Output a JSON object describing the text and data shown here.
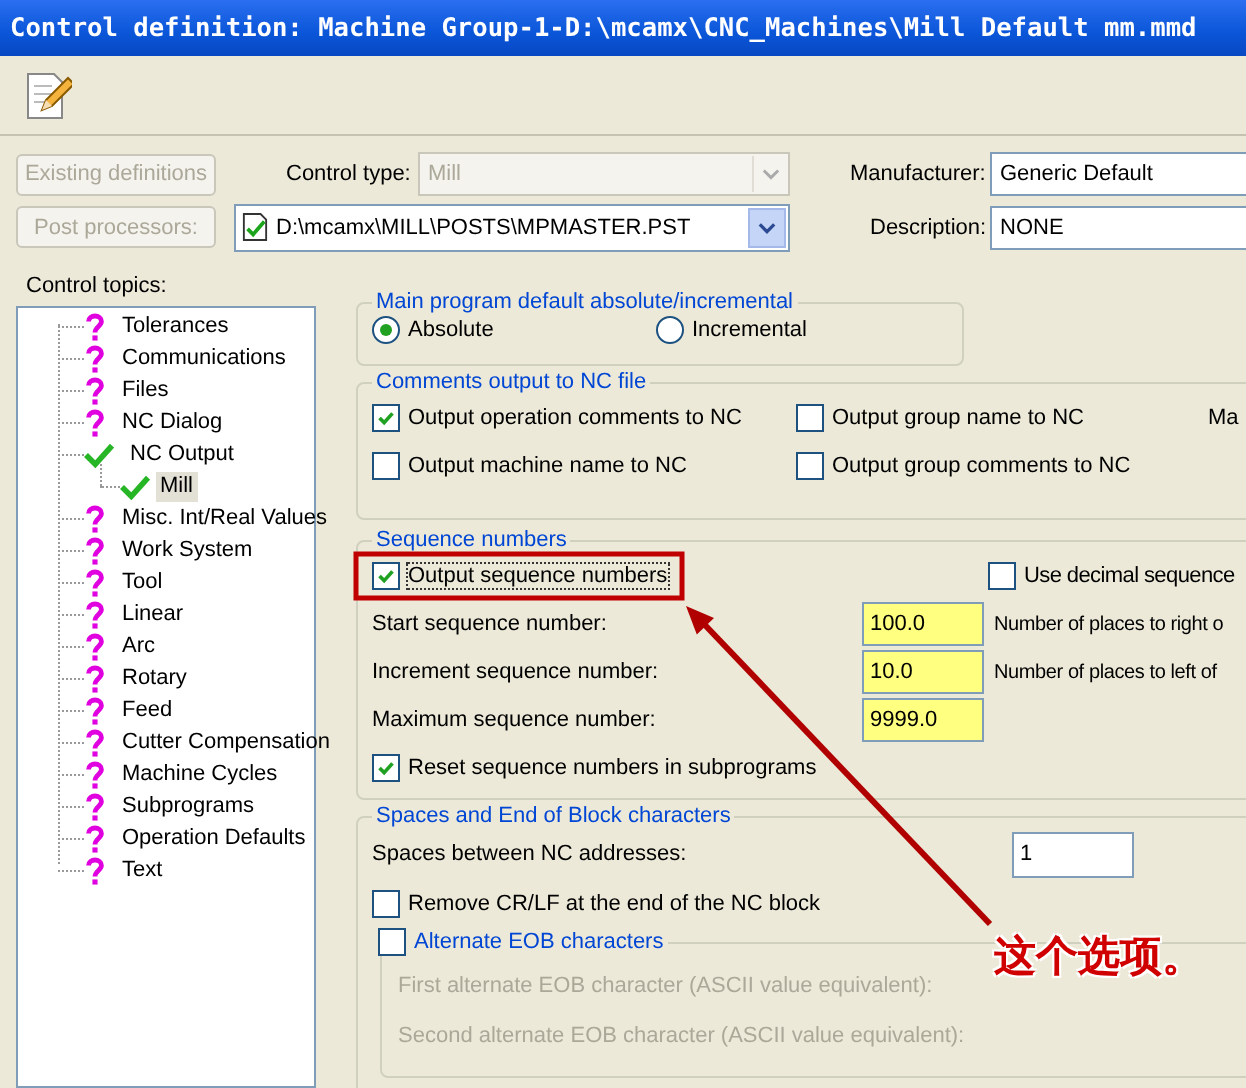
{
  "window": {
    "title": "Control definition: Machine Group-1-D:\\mcamx\\CNC_Machines\\Mill Default mm.mmd"
  },
  "definitions_button": {
    "label": "Existing definitions",
    "disabled": true
  },
  "control_type": {
    "label": "Control type:",
    "value": "Mill",
    "disabled": true
  },
  "post_button": {
    "label": "Post processors:",
    "disabled": true
  },
  "post_file": {
    "value": "D:\\mcamx\\MILL\\POSTS\\MPMASTER.PST"
  },
  "manufacturer": {
    "label": "Manufacturer:",
    "value": "Generic Default"
  },
  "description": {
    "label": "Description:",
    "value": "NONE"
  },
  "topics": {
    "label": "Control topics:",
    "items": [
      {
        "label": "Tolerances",
        "kind": "question",
        "selected": false
      },
      {
        "label": "Communications",
        "kind": "question",
        "selected": false
      },
      {
        "label": "Files",
        "kind": "question",
        "selected": false
      },
      {
        "label": "NC Dialog",
        "kind": "question",
        "selected": false
      },
      {
        "label": "NC Output",
        "kind": "check",
        "selected": false,
        "expanded": true,
        "children": [
          {
            "label": "Mill",
            "kind": "check",
            "selected": true
          }
        ]
      },
      {
        "label": "Misc. Int/Real Values",
        "kind": "question",
        "selected": false
      },
      {
        "label": "Work System",
        "kind": "question",
        "selected": false
      },
      {
        "label": "Tool",
        "kind": "question",
        "selected": false
      },
      {
        "label": "Linear",
        "kind": "question",
        "selected": false
      },
      {
        "label": "Arc",
        "kind": "question",
        "selected": false
      },
      {
        "label": "Rotary",
        "kind": "question",
        "selected": false
      },
      {
        "label": "Feed",
        "kind": "question",
        "selected": false
      },
      {
        "label": "Cutter Compensation",
        "kind": "question",
        "selected": false
      },
      {
        "label": "Machine Cycles",
        "kind": "question",
        "selected": false
      },
      {
        "label": "Subprograms",
        "kind": "question",
        "selected": false
      },
      {
        "label": "Operation Defaults",
        "kind": "question",
        "selected": false
      },
      {
        "label": "Text",
        "kind": "question",
        "selected": false
      }
    ]
  },
  "main_program": {
    "title": "Main program default absolute/incremental",
    "options": [
      {
        "label": "Absolute",
        "selected": true
      },
      {
        "label": "Incremental",
        "selected": false
      }
    ]
  },
  "comments": {
    "title": "Comments output to NC file",
    "options": [
      {
        "label": "Output operation comments to NC",
        "checked": true
      },
      {
        "label": "Output group name to NC",
        "checked": false
      },
      {
        "label": "Output machine name to NC",
        "checked": false
      },
      {
        "label": "Output group comments to NC",
        "checked": false
      }
    ],
    "column_3": "Ma"
  },
  "sequence": {
    "title": "Sequence numbers",
    "output": {
      "label": "Output sequence numbers",
      "checked": true
    },
    "decimal": {
      "label": "Use decimal sequence",
      "checked": false
    },
    "fields": [
      {
        "label": "Start sequence number:",
        "value": "100.0",
        "note": "Number of places to right o"
      },
      {
        "label": "Increment sequence number:",
        "value": "10.0",
        "note": "Number of places to left of"
      },
      {
        "label": "Maximum sequence number:",
        "value": "9999.0"
      }
    ],
    "reset": {
      "label": "Reset sequence numbers in subprograms",
      "checked": true
    }
  },
  "eob": {
    "title": "Spaces and End of Block characters",
    "spaces": {
      "label": "Spaces between NC addresses:",
      "value": "1"
    },
    "remove_crlf": {
      "label": "Remove CR/LF at the end of the NC block",
      "checked": false
    },
    "alternate": {
      "label": "Alternate EOB characters",
      "checked": false,
      "fields": [
        "First alternate EOB character (ASCII value equivalent):",
        "Second alternate EOB character (ASCII value equivalent):"
      ]
    }
  },
  "annotation": {
    "text": "这个选项。"
  }
}
